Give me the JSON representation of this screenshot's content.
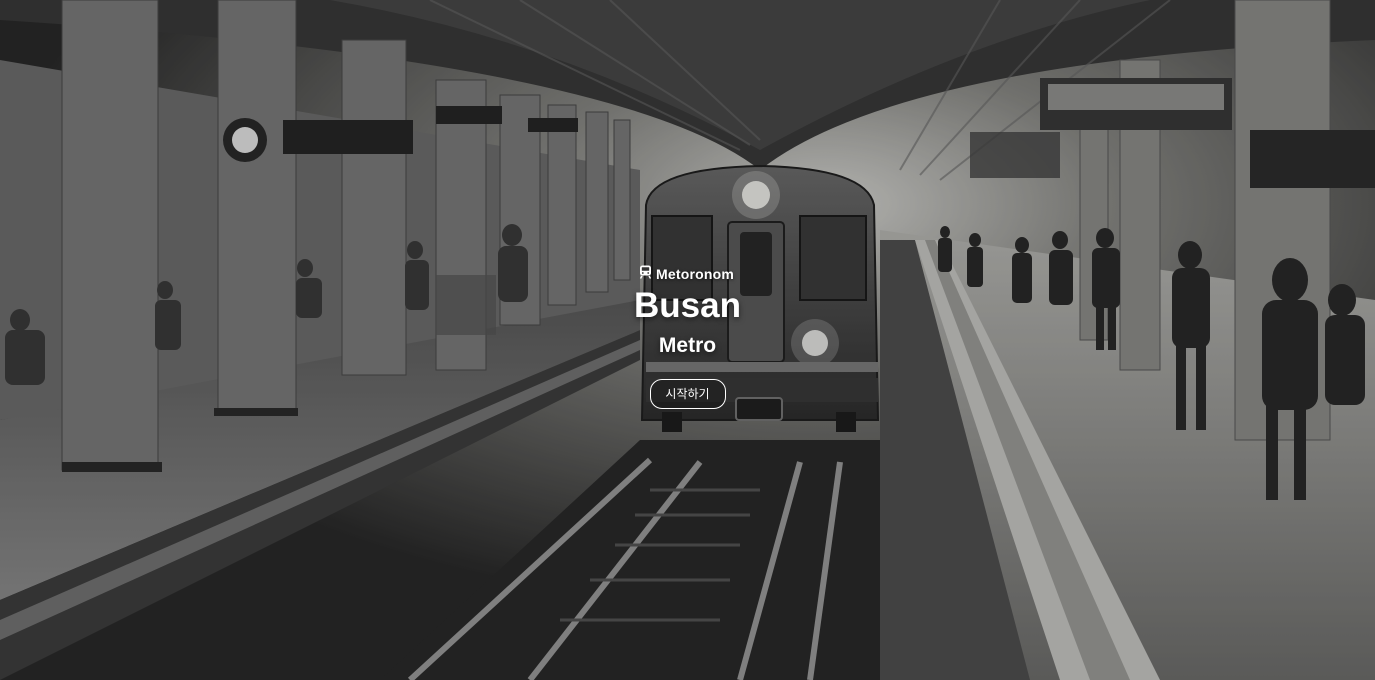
{
  "hero": {
    "brand": "Metoronom",
    "title_line_1": "Busan",
    "title_line_2": "Metro",
    "start_button": "시작하기"
  },
  "icons": {
    "brand_icon": "train-icon"
  },
  "colors": {
    "text": "#ffffff",
    "background_tone": "#5a5a5a"
  }
}
